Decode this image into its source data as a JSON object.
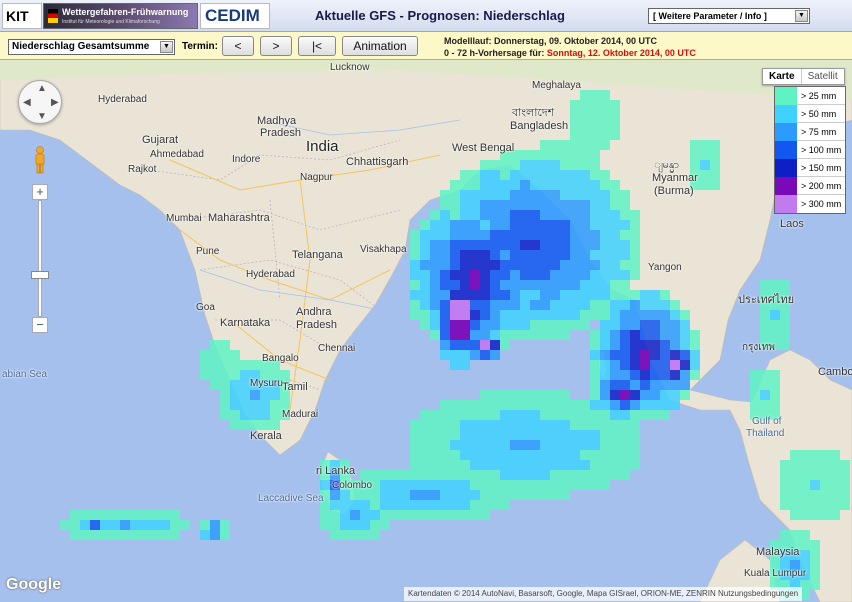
{
  "header": {
    "logo_kit": "KIT",
    "logo_wf_title": "Wettergefahren-Frühwarnung",
    "logo_wf_sub": "Institut für Meteorologie und Klimaforschung",
    "logo_cedim": "CEDIM",
    "title": "Aktuelle GFS - Prognosen: Niederschlag",
    "param_select": "[ Weitere Parameter / Info ]"
  },
  "controls": {
    "variable_select": "Niederschlag Gesamtsumme",
    "termin_label": "Termin:",
    "prev_label": "<",
    "next_label": ">",
    "first_label": "|<",
    "animation_label": "Animation",
    "modelrun": "Modelllauf: Donnerstag, 09. Oktober 2014, 00 UTC",
    "forecast_prefix": "0 - 72 h-Vorhersage für:",
    "forecast_date": "Sonntag, 12. Oktober 2014, 00 UTC"
  },
  "map": {
    "maptype_karte": "Karte",
    "maptype_satellit": "Satellit",
    "google_logo": "Google",
    "attribution": "Kartendaten © 2014 AutoNavi, Basarsoft, Google, Mapa GISrael, ORION-ME, ZENRIN   Nutzungsbedingungen",
    "places": {
      "india": "India",
      "lucknow": "Lucknow",
      "hyderabad_pk": "Hyderabad",
      "gujarat": "Gujarat",
      "ahmedabad": "Ahmedabad",
      "rajkot": "Rajkot",
      "madhya": "Madhya",
      "pradesh": "Pradesh",
      "indore": "Indore",
      "chhattisgarh": "Chhattisgarh",
      "nagpur": "Nagpur",
      "mumbai": "Mumbai",
      "maharashtra": "Maharashtra",
      "pune": "Pune",
      "telangana": "Telangana",
      "hyderabad": "Hyderabad",
      "visakhapatnam": "Visakhapa",
      "goa": "Goa",
      "karnataka": "Karnataka",
      "andhra": "Andhra",
      "pradesh2": "Pradesh",
      "bangalore": "Bangalo",
      "chennai": "Chennai",
      "mysuru": "Mysuru",
      "tamil": "Tamil",
      "kerala": "Kerala",
      "madurai": "Madurai",
      "arabian_sea": "abian Sea",
      "laccadive_sea": "Laccadive Sea",
      "sri_lanka": "ri Lanka",
      "colombo": "Colombo",
      "west_bengal": "West Bengal",
      "bangladesh": "Bangladesh",
      "bangladesh_local": "বাংলাদেশ",
      "meghalaya": "Meghalaya",
      "myanmar_local": "ျမန္မာ",
      "myanmar": "Myanmar",
      "burma": "(Burma)",
      "yangon": "Yangon",
      "laos": "Laos",
      "thailand_local": "ประเทศไทย",
      "bangkok": "กรุงเทพ",
      "gulf_of_thailand": "Gulf of",
      "thailand": "Thailand",
      "cambodia": "Cambo",
      "malaysia": "Malaysia",
      "kuala_lumpur": "Kuala Lumpur"
    }
  },
  "legend": [
    {
      "label": "> 25 mm",
      "color": "#5ff3c4"
    },
    {
      "label": "> 50 mm",
      "color": "#3fd1ff"
    },
    {
      "label": "> 75 mm",
      "color": "#2b9bff"
    },
    {
      "label": "> 100 mm",
      "color": "#1257f0"
    },
    {
      "label": "> 150 mm",
      "color": "#0e1fc8"
    },
    {
      "label": "> 200 mm",
      "color": "#7a0ab8"
    },
    {
      "label": "> 300 mm",
      "color": "#c27af0"
    }
  ]
}
